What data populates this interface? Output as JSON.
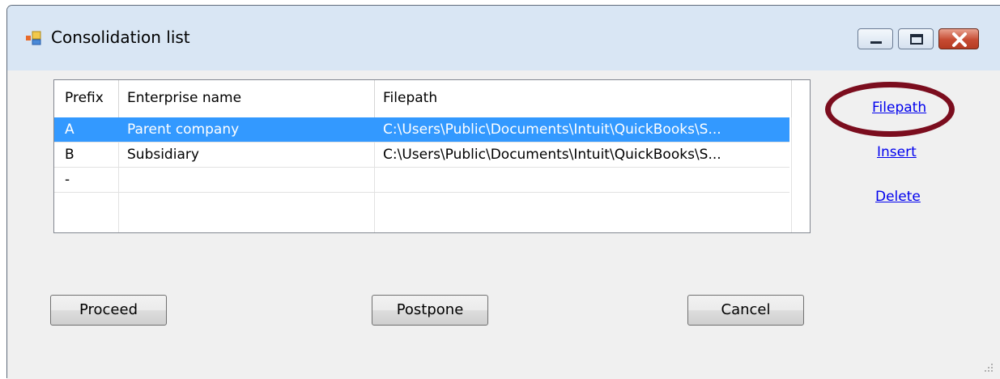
{
  "window": {
    "title": "Consolidation list",
    "icon": "app-window-icon",
    "controls": [
      "minimize-icon",
      "maximize-icon",
      "close-icon"
    ]
  },
  "grid": {
    "columns": [
      "Prefix",
      "Enterprise name",
      "Filepath"
    ],
    "rows": [
      {
        "prefix": "A",
        "name": "Parent company",
        "path": "C:\\Users\\Public\\Documents\\Intuit\\QuickBooks\\S...",
        "selected": true
      },
      {
        "prefix": "B",
        "name": "Subsidiary",
        "path": "C:\\Users\\Public\\Documents\\Intuit\\QuickBooks\\S...",
        "selected": false
      },
      {
        "prefix": "-",
        "name": "",
        "path": "",
        "selected": false
      }
    ]
  },
  "side_links": {
    "filepath": "Filepath",
    "insert": "Insert",
    "delete": "Delete"
  },
  "buttons": {
    "proceed": "Proceed",
    "postpone": "Postpone",
    "cancel": "Cancel"
  },
  "colors": {
    "selection": "#3399ff",
    "link": "#0000ee",
    "highlight_ellipse": "#7b0d1e"
  }
}
